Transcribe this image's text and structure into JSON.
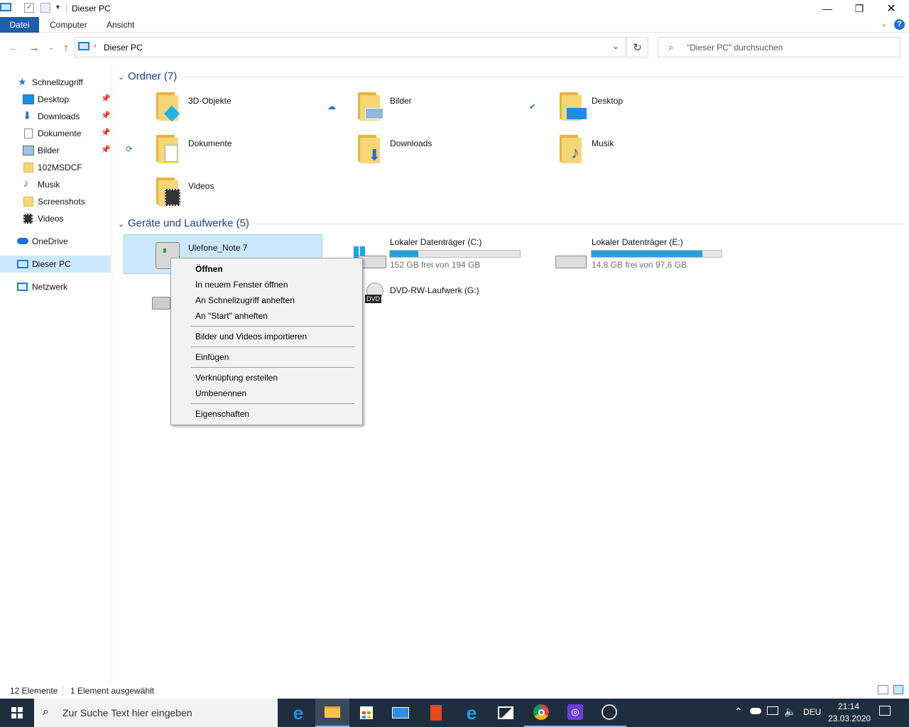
{
  "window": {
    "title": "Dieser PC"
  },
  "ribbon": {
    "tabs": [
      "Datei",
      "Computer",
      "Ansicht"
    ]
  },
  "address": {
    "location": "Dieser PC"
  },
  "search": {
    "placeholder": "\"Dieser PC\" durchsuchen"
  },
  "sidebar": {
    "quick_access": "Schnellzugriff",
    "items": [
      "Desktop",
      "Downloads",
      "Dokumente",
      "Bilder",
      "102MSDCF",
      "Musik",
      "Screenshots",
      "Videos"
    ],
    "onedrive": "OneDrive",
    "this_pc": "Dieser PC",
    "network": "Netzwerk"
  },
  "content": {
    "folders_header": "Ordner (7)",
    "folders": [
      "3D-Objekte",
      "Bilder",
      "Desktop",
      "Dokumente",
      "Downloads",
      "Musik",
      "Videos"
    ],
    "devices_header": "Geräte und Laufwerke (5)",
    "devices": [
      {
        "name": "Ulefone_Note 7"
      },
      {
        "name": "Lokaler Datenträger (C:)",
        "free": "152 GB frei von 194 GB",
        "used_fraction": 0.22
      },
      {
        "name": "Lokaler Datenträger (E:)",
        "free": "14,8 GB frei von 97,6 GB",
        "used_fraction": 0.85
      },
      {
        "name": "DVD-RW-Laufwerk (G:)",
        "badge": "DVD"
      }
    ]
  },
  "context_menu": {
    "items": [
      "Öffnen",
      "In neuem Fenster öffnen",
      "An Schnellzugriff anheften",
      "An \"Start\" anheften",
      "Bilder und Videos importieren",
      "Einfügen",
      "Verknüpfung erstellen",
      "Umbenennen",
      "Eigenschaften"
    ]
  },
  "statusbar": {
    "count": "12 Elemente",
    "selected": "1 Element ausgewählt"
  },
  "taskbar": {
    "search_placeholder": "Zur Suche Text hier eingeben",
    "language": "DEU",
    "time": "21:14",
    "date": "23.03.2020"
  },
  "colors": {
    "accent": "#1b60a9",
    "selection": "#cce8ff",
    "drive_bar": "#26a0da",
    "taskbar": "#1f2e3f"
  }
}
